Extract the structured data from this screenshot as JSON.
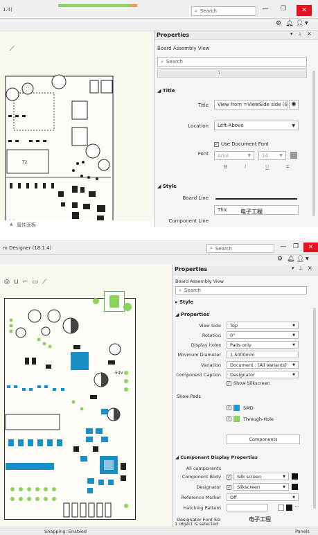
{
  "top": {
    "window_title": "1.4)",
    "search_placeholder": "Search",
    "panel_title": "Properties",
    "panel_subtitle": "Board Assembly View",
    "panel_search": "Search",
    "spin_value": "1",
    "section_title": "Title",
    "title_label": "Title",
    "title_value": "View from =ViewSide side (S:",
    "location_label": "Location",
    "location_value": "Left-Above",
    "font_label": "Font",
    "use_doc_font": "Use Document Font",
    "font_name": "Arial",
    "font_size": "14",
    "fmt_bold": "B",
    "fmt_italic": "I",
    "fmt_underline": "U",
    "fmt_strike": "T",
    "section_style": "Style",
    "border_line_label": "Board Line",
    "thickness_value": "Thic",
    "component_line_label": "Component Line",
    "watermark": "电子工程",
    "caption": "属性面板"
  },
  "bottom": {
    "window_title": "m Designer (18.1.4)",
    "search_placeholder": "Search",
    "panel_title": "Properties",
    "panel_subtitle": "Board Assembly View",
    "panel_search": "Search",
    "section_style": "Style",
    "section_properties": "Properties",
    "view_side_label": "View Side",
    "view_side_value": "Top",
    "rotation_label": "Rotation",
    "rotation_value": "0°",
    "display_holes_label": "Display holes",
    "display_holes_value": "Pads only",
    "min_diameter_label": "Minimum Diameter",
    "min_diameter_value": "1.5000mm",
    "variation_label": "Variation",
    "variation_value": "Document : [All Variants]",
    "component_caption_label": "Component Caption",
    "component_caption_value": "Designator",
    "show_silkscreen": "Show Silkscreen",
    "show_pads_label": "Show Pads",
    "smd_label": "SMD",
    "through_hole_label": "Through-Hole",
    "components_button": "Components",
    "section_component_display": "Component Display Properties",
    "all_components": "All components",
    "component_body_label": "Component Body",
    "component_body_value": "Silk screen",
    "designator_label": "Designator",
    "designator_value": "Silkscreen",
    "reference_marker_label": "Reference Marker",
    "reference_marker_value": "Off",
    "hatching_pattern_label": "Hatching Pattern",
    "designator_font_label": "Designator Font Siz",
    "selection_status": "1 object is selected",
    "snapping_status": "Snapping: Enabled",
    "panels_button": "Panels",
    "watermark": "电子工程",
    "pcb_label_voltage": "54V"
  },
  "colors": {
    "smd": "#1a9ad6",
    "through_hole": "#8bd35a",
    "close": "#e81123"
  }
}
